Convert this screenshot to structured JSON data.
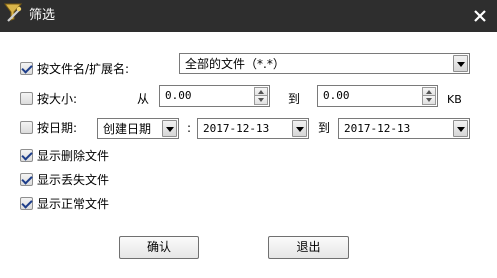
{
  "window": {
    "title": "筛选",
    "icon": "filter-wand-icon",
    "close_icon": "close-icon"
  },
  "filters": {
    "by_name": {
      "checked": true,
      "label": "按文件名/扩展名:",
      "value": "全部的文件（*.*）"
    },
    "by_size": {
      "checked": false,
      "label": "按大小:",
      "from_label": "从",
      "from_value": "0.00",
      "to_label": "到",
      "to_value": "0.00",
      "unit": "KB"
    },
    "by_date": {
      "checked": false,
      "label": "按日期:",
      "date_type": "创建日期",
      "colon": ":",
      "start": "2017-12-13",
      "to_label": "到",
      "end": "2017-12-13"
    }
  },
  "options": [
    {
      "label": "显示删除文件",
      "checked": true
    },
    {
      "label": "显示丢失文件",
      "checked": true
    },
    {
      "label": "显示正常文件",
      "checked": true
    }
  ],
  "buttons": {
    "ok": "确认",
    "exit": "退出"
  },
  "colors": {
    "titlebar": "#2e2e2e",
    "title_text": "#ffffff",
    "check_mark": "#1e3e8a"
  }
}
